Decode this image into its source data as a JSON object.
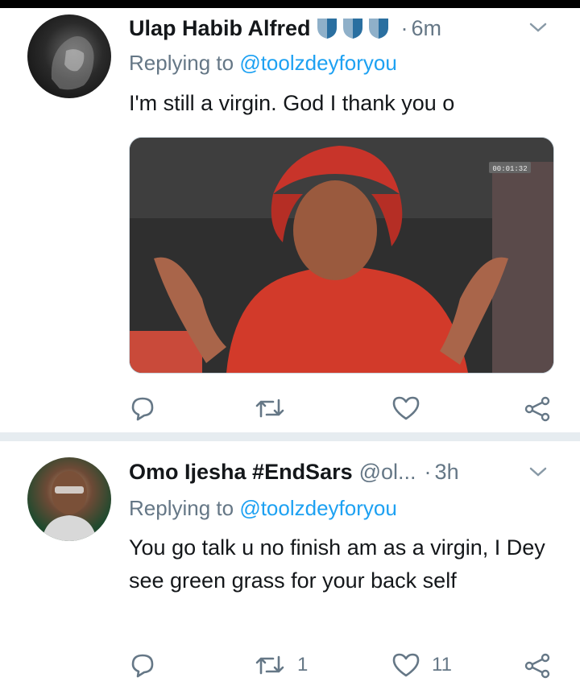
{
  "tweets": [
    {
      "name": "Ulap Habib Alfred",
      "handle": "",
      "time": "6m",
      "replying_prefix": "Replying to ",
      "replying_to": "@toolzdeyforyou",
      "text": "I'm still a virgin. God I thank you o",
      "media_timestamp": "00:01:32",
      "retweets": "",
      "likes": ""
    },
    {
      "name": "Omo Ijesha #EndSars",
      "handle": "@ol...",
      "time": "3h",
      "replying_prefix": "Replying to ",
      "replying_to": "@toolzdeyforyou",
      "text": "You go talk u no finish am as a virgin, I Dey see green grass for your back self",
      "retweets": "1",
      "likes": "11"
    }
  ],
  "colors": {
    "link": "#1da1f2",
    "secondary_text": "#657786",
    "divider": "#e6ecf0"
  }
}
